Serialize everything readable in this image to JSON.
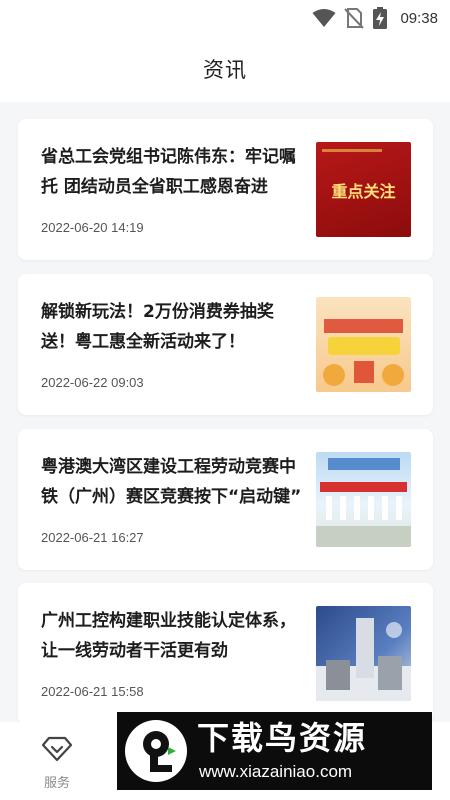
{
  "status_bar": {
    "time": "09:38",
    "icons": [
      "wifi-icon",
      "no-sim-icon",
      "battery-charging-icon"
    ]
  },
  "header": {
    "title": "资讯"
  },
  "news": [
    {
      "title": "省总工会党组书记陈伟东：牢记嘱托 团结动员全省职工感恩奋进",
      "date": "2022-06-20 14:19",
      "thumb_text": "重点关注"
    },
    {
      "title": "解锁新玩法！2万份消费券抽奖送！粤工惠全新活动来了！",
      "date": "2022-06-22 09:03",
      "thumb_text": ""
    },
    {
      "title": "粤港澳大湾区建设工程劳动竞赛中铁（广州）赛区竞赛按下“启动键”",
      "date": "2022-06-21 16:27",
      "thumb_text": ""
    },
    {
      "title": "广州工控构建职业技能认定体系，让一线劳动者干活更有劲",
      "date": "2022-06-21 15:58",
      "thumb_text": ""
    }
  ],
  "bottom_nav": {
    "items": [
      {
        "label": "服务",
        "icon": "diamond-heart-icon"
      }
    ]
  },
  "watermark": {
    "title": "下载鸟资源",
    "url": "www.xiazainiao.com"
  },
  "colors": {
    "background": "#f5f6f8",
    "card": "#ffffff",
    "watermark_bg": "#0c0c0c"
  }
}
